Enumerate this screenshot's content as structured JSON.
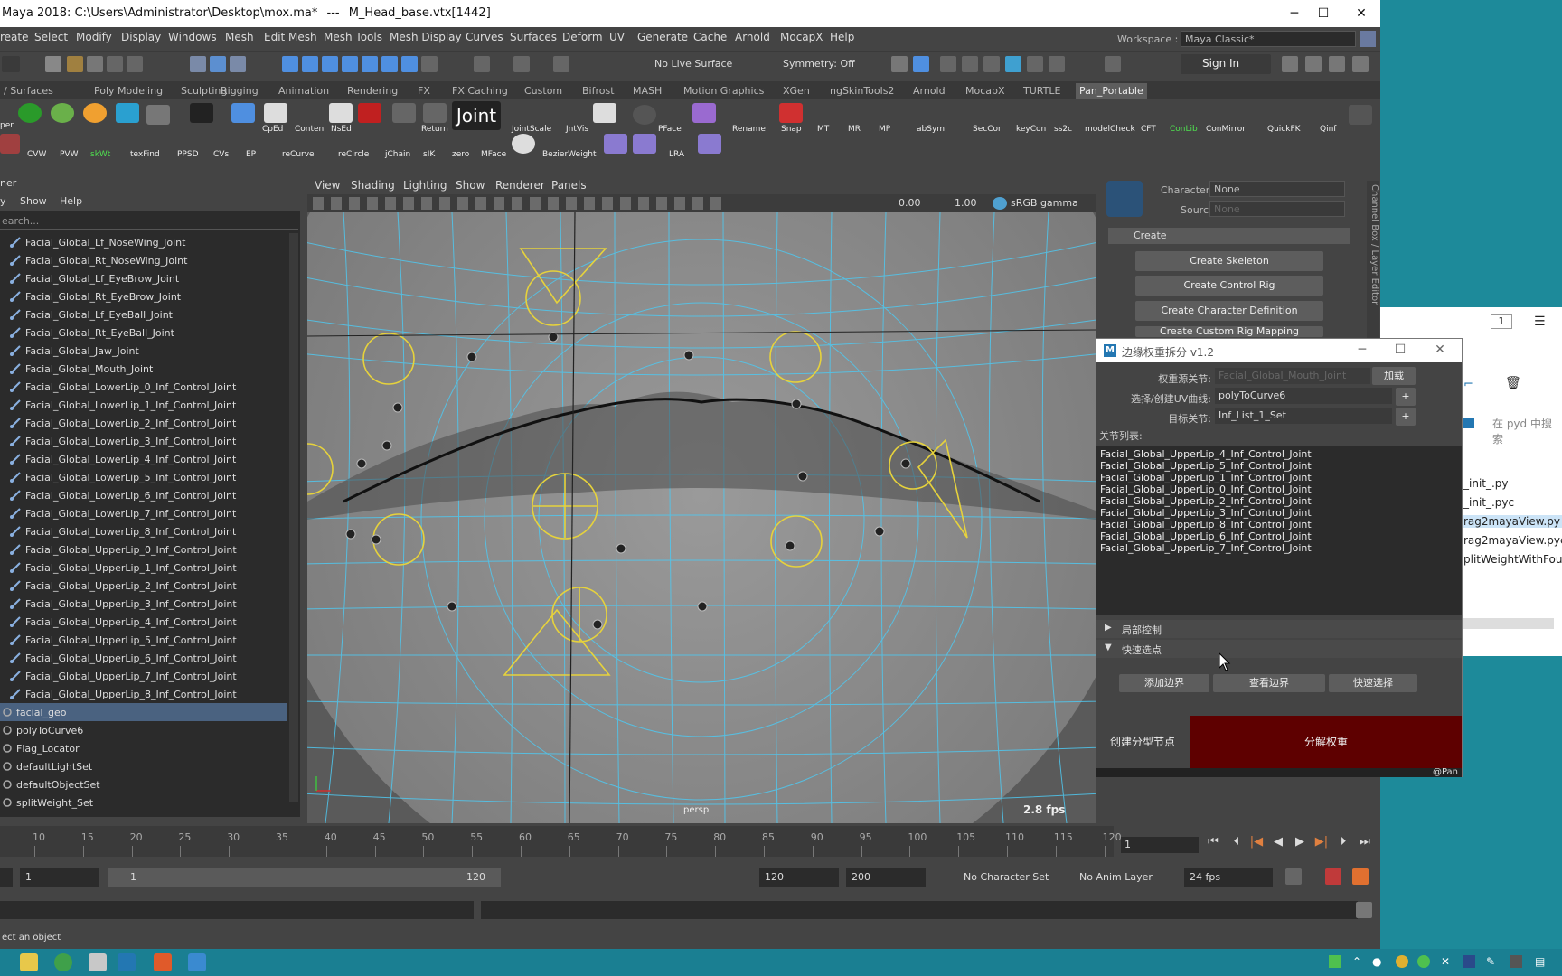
{
  "window": {
    "title": "Maya 2018: C:\\Users\\Administrator\\Desktop\\mox.ma*",
    "separator": "---",
    "selection": "M_Head_base.vtx[1442]",
    "minimize": "─",
    "maximize": "☐",
    "close": "✕"
  },
  "menu": [
    "reate",
    "Select",
    "Modify",
    "Display",
    "Windows",
    "Mesh",
    "Edit Mesh",
    "Mesh Tools",
    "Mesh Display",
    "Curves",
    "Surfaces",
    "Deform",
    "UV",
    "Generate",
    "Cache",
    "Arnold",
    "MocapX",
    "Help"
  ],
  "workspace": {
    "label": "Workspace :",
    "value": "Maya Classic*"
  },
  "statusline": {
    "live_surface": "No Live Surface",
    "symmetry": "Symmetry: Off",
    "sign_in": "Sign In"
  },
  "shelf_tabs": [
    "/ Surfaces",
    "Poly Modeling",
    "Sculpting",
    "Rigging",
    "Animation",
    "Rendering",
    "FX",
    "FX Caching",
    "Custom",
    "Bifrost",
    "MASH",
    "Motion Graphics",
    "XGen",
    "ngSkinTools2",
    "Arnold",
    "MocapX",
    "TURTLE",
    "Pan_Portable"
  ],
  "shelf_row1": [
    "CpEd",
    "Conten",
    "NsEd",
    "Return",
    "JointScale",
    "JntVis",
    "PFace",
    "Rename",
    "Snap",
    "MT",
    "MR",
    "MP",
    "abSym",
    "SecCon",
    "keyCon",
    "ss2c",
    "modelCheck",
    "CFT",
    "ConLib",
    "ConMirror",
    "QuickFK",
    "Qinf"
  ],
  "shelf_row2": [
    "CVW",
    "PVW",
    "skWt",
    "texFind",
    "PPSD",
    "CVs",
    "EP",
    "reCurve",
    "reCircle",
    "jChain",
    "sIK",
    "zero",
    "MFace",
    "BezierWeight",
    "LRA"
  ],
  "shelf_joint": "Joint",
  "shelf_first": "per",
  "outliner": {
    "title": "ner",
    "menus": [
      "y",
      "Show",
      "Help"
    ],
    "search": "earch...",
    "items": [
      "Facial_Global_Lf_NoseWing_Joint",
      "Facial_Global_Rt_NoseWing_Joint",
      "Facial_Global_Lf_EyeBrow_Joint",
      "Facial_Global_Rt_EyeBrow_Joint",
      "Facial_Global_Lf_EyeBall_Joint",
      "Facial_Global_Rt_EyeBall_Joint",
      "Facial_Global_Jaw_Joint",
      "Facial_Global_Mouth_Joint",
      "Facial_Global_LowerLip_0_Inf_Control_Joint",
      "Facial_Global_LowerLip_1_Inf_Control_Joint",
      "Facial_Global_LowerLip_2_Inf_Control_Joint",
      "Facial_Global_LowerLip_3_Inf_Control_Joint",
      "Facial_Global_LowerLip_4_Inf_Control_Joint",
      "Facial_Global_LowerLip_5_Inf_Control_Joint",
      "Facial_Global_LowerLip_6_Inf_Control_Joint",
      "Facial_Global_LowerLip_7_Inf_Control_Joint",
      "Facial_Global_LowerLip_8_Inf_Control_Joint",
      "Facial_Global_UpperLip_0_Inf_Control_Joint",
      "Facial_Global_UpperLip_1_Inf_Control_Joint",
      "Facial_Global_UpperLip_2_Inf_Control_Joint",
      "Facial_Global_UpperLip_3_Inf_Control_Joint",
      "Facial_Global_UpperLip_4_Inf_Control_Joint",
      "Facial_Global_UpperLip_5_Inf_Control_Joint",
      "Facial_Global_UpperLip_6_Inf_Control_Joint",
      "Facial_Global_UpperLip_7_Inf_Control_Joint",
      "Facial_Global_UpperLip_8_Inf_Control_Joint"
    ],
    "top_items": [
      "facial_geo",
      "polyToCurve6",
      "Flag_Locator",
      "defaultLightSet",
      "defaultObjectSet",
      "splitWeight_Set"
    ]
  },
  "viewport": {
    "menus": [
      "View",
      "Shading",
      "Lighting",
      "Show",
      "Renderer",
      "Panels"
    ],
    "exposure": "0.00",
    "gamma": "1.00",
    "color_space": "sRGB gamma",
    "camera": "persp",
    "fps": "2.8 fps"
  },
  "hik": {
    "character_label": "Character:",
    "character_value": "None",
    "source_label": "Source:",
    "source_value": "None",
    "section": "Create",
    "buttons": [
      "Create Skeleton",
      "Create Control Rig",
      "Create Character Definition",
      "Create Custom Rig Mapping"
    ],
    "side_tab": "Channel Box / Layer Editor"
  },
  "timeline": {
    "ticks": [
      "10",
      "15",
      "20",
      "25",
      "30",
      "35",
      "40",
      "45",
      "50",
      "55",
      "60",
      "65",
      "70",
      "75",
      "80",
      "85",
      "90",
      "95",
      "100",
      "105",
      "110",
      "115",
      "120"
    ],
    "current_frame": "1",
    "range_start": "1",
    "range_inner_start": "1",
    "range_inner_end": "120",
    "range_end": "120",
    "anim_end": "200",
    "character_set": "No Character Set",
    "anim_layer": "No Anim Layer",
    "fps": "24 fps"
  },
  "help_line": "ect an object",
  "tool": {
    "title": "边缘权重拆分 v1.2",
    "source_label": "权重源关节:",
    "source_value": "Facial_Global_Mouth_Joint",
    "load_button": "加载",
    "curve_label": "选择/创建UV曲线:",
    "curve_value": "polyToCurve6",
    "target_label": "目标关节:",
    "target_value": "Inf_List_1_Set",
    "plus": "+",
    "list_label": "关节列表:",
    "joints": [
      "Facial_Global_UpperLip_4_Inf_Control_Joint",
      "Facial_Global_UpperLip_5_Inf_Control_Joint",
      "Facial_Global_UpperLip_1_Inf_Control_Joint",
      "Facial_Global_UpperLip_0_Inf_Control_Joint",
      "Facial_Global_UpperLip_2_Inf_Control_Joint",
      "Facial_Global_UpperLip_3_Inf_Control_Joint",
      "Facial_Global_UpperLip_8_Inf_Control_Joint",
      "Facial_Global_UpperLip_6_Inf_Control_Joint",
      "Facial_Global_UpperLip_7_Inf_Control_Joint"
    ],
    "fold_local": "局部控制",
    "fold_quick": "快速选点",
    "btn_add_border": "添加边界",
    "btn_view_border": "查看边界",
    "btn_quick_select": "快速选择",
    "btn_create_node": "创建分型节点",
    "btn_split": "分解权重",
    "credit": "@Pan"
  },
  "bgwin": {
    "page": "1",
    "search": "在 pyd 中搜索",
    "files": [
      "_init_.py",
      "_init_.pyc",
      "rag2mayaView.py",
      "rag2mayaView.pyc",
      "plitWeightWithFour"
    ]
  },
  "colors": {
    "viewport_bg": "#5c5c5c",
    "wire": "#4fc8f0",
    "locator": "#e6d23c",
    "split_button": "#5e0000",
    "desktop": "#1d8a9a"
  }
}
